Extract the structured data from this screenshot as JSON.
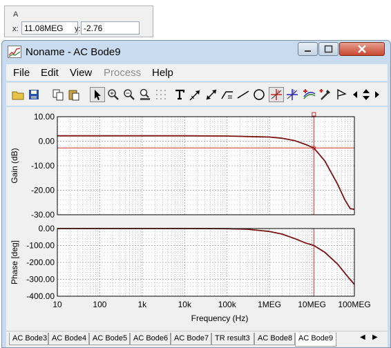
{
  "cursor_readout": {
    "caption": "A",
    "x_label": "x:",
    "x_value": "11.08MEG",
    "y_label": "y:",
    "y_value": "-2.76"
  },
  "window": {
    "title": "Noname - AC Bode9"
  },
  "menu": {
    "file": "File",
    "edit": "Edit",
    "view": "View",
    "process": "Process",
    "help": "Help"
  },
  "toolbar_icons": [
    "open-icon",
    "save-icon",
    "copy-icon",
    "paste-icon",
    "select-arrow-icon",
    "zoom-in-icon",
    "zoom-out-icon",
    "zoom-100-icon",
    "grid-icon",
    "text-icon",
    "arrow-annotation-icon",
    "dimension-icon",
    "curve-annotation-icon",
    "line-icon",
    "circle-icon",
    "cursor-a-icon",
    "cursor-b-icon",
    "add-trace-icon",
    "probe-icon",
    "flag-icon",
    "scroll-left-icon",
    "scroll-updown-icon",
    "scroll-right-icon"
  ],
  "chart_data": [
    {
      "type": "line",
      "ylabel": "Gain (dB)",
      "xlabel": "",
      "x_scale": "log",
      "xlim": [
        10,
        100000000
      ],
      "ylim": [
        -30,
        10
      ],
      "ytick_labels": [
        "10.00",
        "0.00",
        "-10.00",
        "-20.00",
        "-30.00"
      ],
      "grid": true,
      "series": [
        {
          "x": [
            10,
            100,
            1000,
            10000,
            100000,
            1000000,
            2000000,
            4000000,
            7000000,
            11080000,
            20000000,
            40000000,
            60000000,
            80000000,
            100000000
          ],
          "values": [
            2.2,
            2.2,
            2.2,
            2.2,
            2.1,
            1.7,
            1.2,
            0.2,
            -1.3,
            -2.76,
            -8.0,
            -17.5,
            -24.0,
            -27.5,
            -27.8
          ]
        }
      ],
      "cursor": {
        "x": 11080000,
        "y": -2.76
      }
    },
    {
      "type": "line",
      "ylabel": "Phase [deg]",
      "xlabel": "Frequency (Hz)",
      "x_scale": "log",
      "xlim": [
        10,
        100000000
      ],
      "ylim": [
        -400,
        0
      ],
      "ytick_labels": [
        "0.00",
        "-100.00",
        "-200.00",
        "-300.00",
        "-400.00"
      ],
      "xtick_labels": [
        "10",
        "100",
        "1k",
        "10k",
        "100k",
        "1MEG",
        "10MEG",
        "100MEG"
      ],
      "grid": true,
      "series": [
        {
          "x": [
            10,
            100,
            1000,
            10000,
            100000,
            300000,
            1000000,
            2000000,
            4000000,
            7000000,
            11080000,
            20000000,
            40000000,
            70000000,
            100000000
          ],
          "values": [
            0,
            0,
            0,
            0,
            -1,
            -4,
            -17,
            -33,
            -60,
            -85,
            -100,
            -140,
            -210,
            -285,
            -330
          ]
        }
      ],
      "cursor": {
        "x": 11080000
      }
    }
  ],
  "colors": {
    "trace": "#7a1010",
    "cursor": "#cc2a2a",
    "grid": "#9a9a9a"
  },
  "tabs": [
    "AC Bode3",
    "AC Bode4",
    "AC Bode5",
    "AC Bode6",
    "AC Bode7",
    "TR result3",
    "AC Bode8",
    "AC Bode9"
  ],
  "active_tab": "AC Bode9"
}
